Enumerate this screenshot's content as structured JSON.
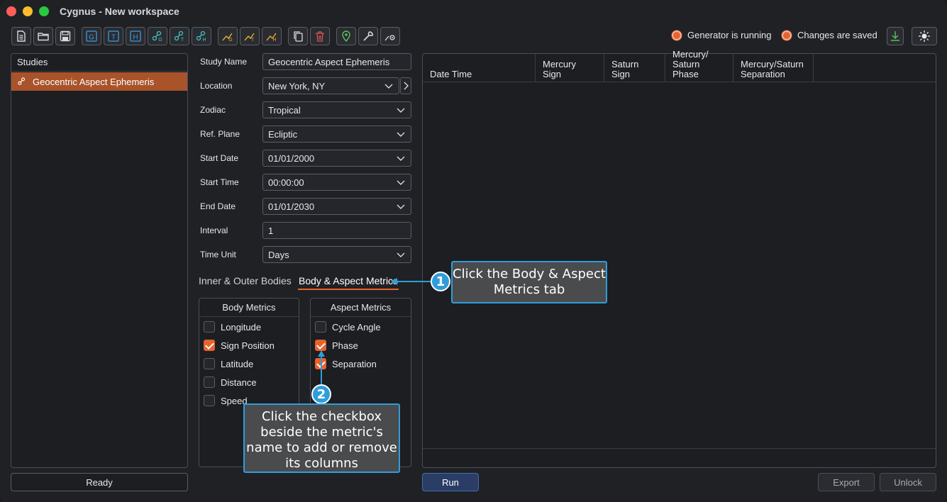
{
  "window": {
    "title": "Cygnus - New workspace"
  },
  "toolbar": {
    "icons": [
      "new-file-icon",
      "open-folder-icon",
      "save-icon",
      "g-icon",
      "t-icon",
      "h-icon",
      "geocentric-study-icon",
      "heliocentric-study-icon",
      "study-h-icon",
      "chart-g-icon",
      "chart-t-icon",
      "chart-h-icon",
      "copy-icon",
      "delete-icon",
      "location-pin-icon",
      "wrench-icon",
      "settings-gear-icon"
    ],
    "status_generator": "Generator is running",
    "status_saved": "Changes are saved",
    "accent": "#e8622e"
  },
  "studies": {
    "header": "Studies",
    "items": [
      {
        "label": "Geocentric Aspect Ephemeris"
      }
    ],
    "status": "Ready"
  },
  "form": {
    "study_name": {
      "label": "Study Name",
      "value": "Geocentric Aspect Ephemeris"
    },
    "location": {
      "label": "Location",
      "value": "New York, NY"
    },
    "zodiac": {
      "label": "Zodiac",
      "value": "Tropical"
    },
    "ref_plane": {
      "label": "Ref. Plane",
      "value": "Ecliptic"
    },
    "start_date": {
      "label": "Start Date",
      "value": "01/01/2000"
    },
    "start_time": {
      "label": "Start Time",
      "value": "00:00:00"
    },
    "end_date": {
      "label": "End Date",
      "value": "01/01/2030"
    },
    "interval": {
      "label": "Interval",
      "value": "1"
    },
    "time_unit": {
      "label": "Time Unit",
      "value": "Days"
    }
  },
  "tabs": {
    "inner_outer": "Inner & Outer Bodies",
    "body_aspect": "Body & Aspect Metrics"
  },
  "body_metrics": {
    "header": "Body Metrics",
    "items": [
      {
        "label": "Longitude",
        "checked": false
      },
      {
        "label": "Sign Position",
        "checked": true
      },
      {
        "label": "Latitude",
        "checked": false
      },
      {
        "label": "Distance",
        "checked": false
      },
      {
        "label": "Speed",
        "checked": false
      }
    ]
  },
  "aspect_metrics": {
    "header": "Aspect Metrics",
    "items": [
      {
        "label": "Cycle Angle",
        "checked": false
      },
      {
        "label": "Phase",
        "checked": true
      },
      {
        "label": "Separation",
        "checked": true
      }
    ]
  },
  "results": {
    "columns": [
      {
        "line1": "",
        "line2": "Date Time"
      },
      {
        "line1": "",
        "line2": "Mercury Sign"
      },
      {
        "line1": "",
        "line2": "Saturn Sign"
      },
      {
        "line1": "Mercury/",
        "line2": "Saturn Phase"
      },
      {
        "line1": "Mercury/Saturn",
        "line2": "Separation"
      }
    ]
  },
  "buttons": {
    "run": "Run",
    "export": "Export",
    "unlock": "Unlock"
  },
  "callouts": {
    "c1": {
      "number": "1",
      "text": "Click the Body & Aspect Metrics tab"
    },
    "c2": {
      "number": "2",
      "text": "Click the checkbox beside the metric's name to add or remove its columns"
    }
  }
}
